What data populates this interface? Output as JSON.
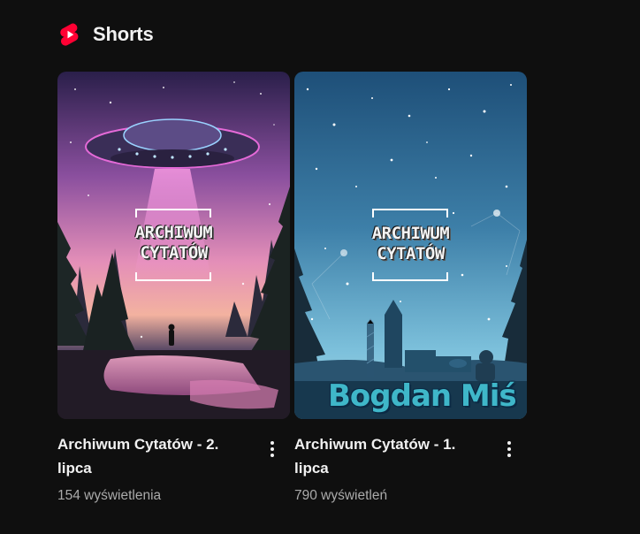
{
  "shelf": {
    "title": "Shorts",
    "logo_icon": "youtube-shorts-icon",
    "accent_color": "#ff0033"
  },
  "cards": [
    {
      "title": "Archiwum Cytatów - 2. lipca",
      "views": "154 wyświetlenia",
      "thumbnail_text": "ARCHIWUM\nCYTATÓW",
      "menu_icon": "more-vert-icon"
    },
    {
      "title": "Archiwum Cytatów - 1. lipca",
      "views": "790 wyświetleń",
      "thumbnail_text": "ARCHIWUM\nCYTATÓW",
      "thumbnail_brand": "Bogdan Miś",
      "menu_icon": "more-vert-icon"
    }
  ]
}
